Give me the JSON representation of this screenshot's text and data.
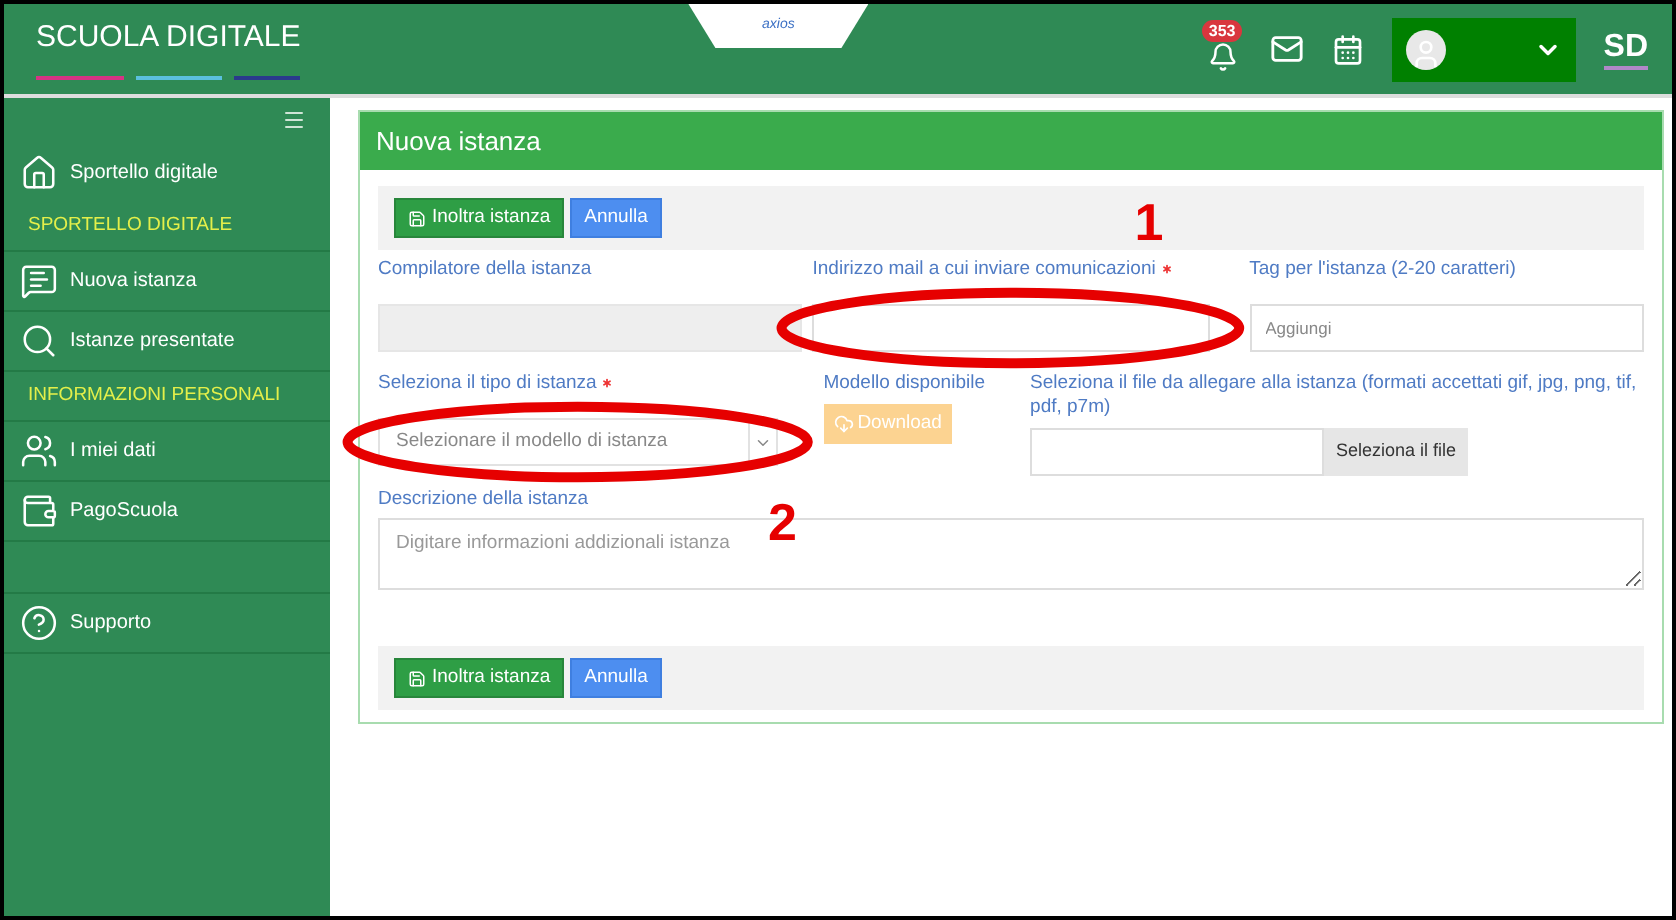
{
  "header": {
    "logo": "SCUOLA DIGITALE",
    "partner_logo": "axios",
    "notifications_count": "353",
    "user_initials": "SD"
  },
  "sidebar": {
    "items": [
      {
        "kind": "link",
        "label": "Sportello digitale"
      },
      {
        "kind": "section",
        "label": "SPORTELLO DIGITALE"
      },
      {
        "kind": "link",
        "label": "Nuova istanza"
      },
      {
        "kind": "link",
        "label": "Istanze presentate"
      },
      {
        "kind": "section",
        "label": "INFORMAZIONI PERSONALI"
      },
      {
        "kind": "link",
        "label": "I miei dati"
      },
      {
        "kind": "link",
        "label": "PagoScuola"
      },
      {
        "kind": "spacer_link",
        "label": "Supporto"
      }
    ]
  },
  "form": {
    "title": "Nuova istanza",
    "toolbar": [
      {
        "kind": "submit",
        "label": "Inoltra istanza"
      },
      {
        "kind": "cancel",
        "label": "Annulla"
      }
    ],
    "compiler": {
      "label": "Compilatore della istanza",
      "disabled": true
    },
    "email": {
      "label": "Indirizzo mail a cui inviare comunicazioni",
      "required": true
    },
    "tags": {
      "label": "Tag per l'istanza (2-20 caratteri)",
      "placeholder": "Aggiungi"
    },
    "type_select": {
      "label": "Seleziona il tipo di istanza",
      "required": true,
      "placeholder": "Selezionare il modello di istanza"
    },
    "model": {
      "label": "Modello disponibile",
      "button": "Download",
      "disabled": true
    },
    "file": {
      "label": "Seleziona il file da allegare alla istanza (formati accettati gif, jpg, png, tif, pdf, p7m)",
      "button": "Seleziona il file"
    },
    "description": {
      "label": "Descrizione della istanza",
      "placeholder": "Digitare informazioni addizionali istanza"
    },
    "bottom_toolbar": [
      {
        "kind": "submit",
        "label": "Inoltra istanza"
      },
      {
        "kind": "cancel",
        "label": "Annulla"
      }
    ]
  },
  "annotations": [
    {
      "label": "1"
    },
    {
      "label": "2"
    }
  ]
}
